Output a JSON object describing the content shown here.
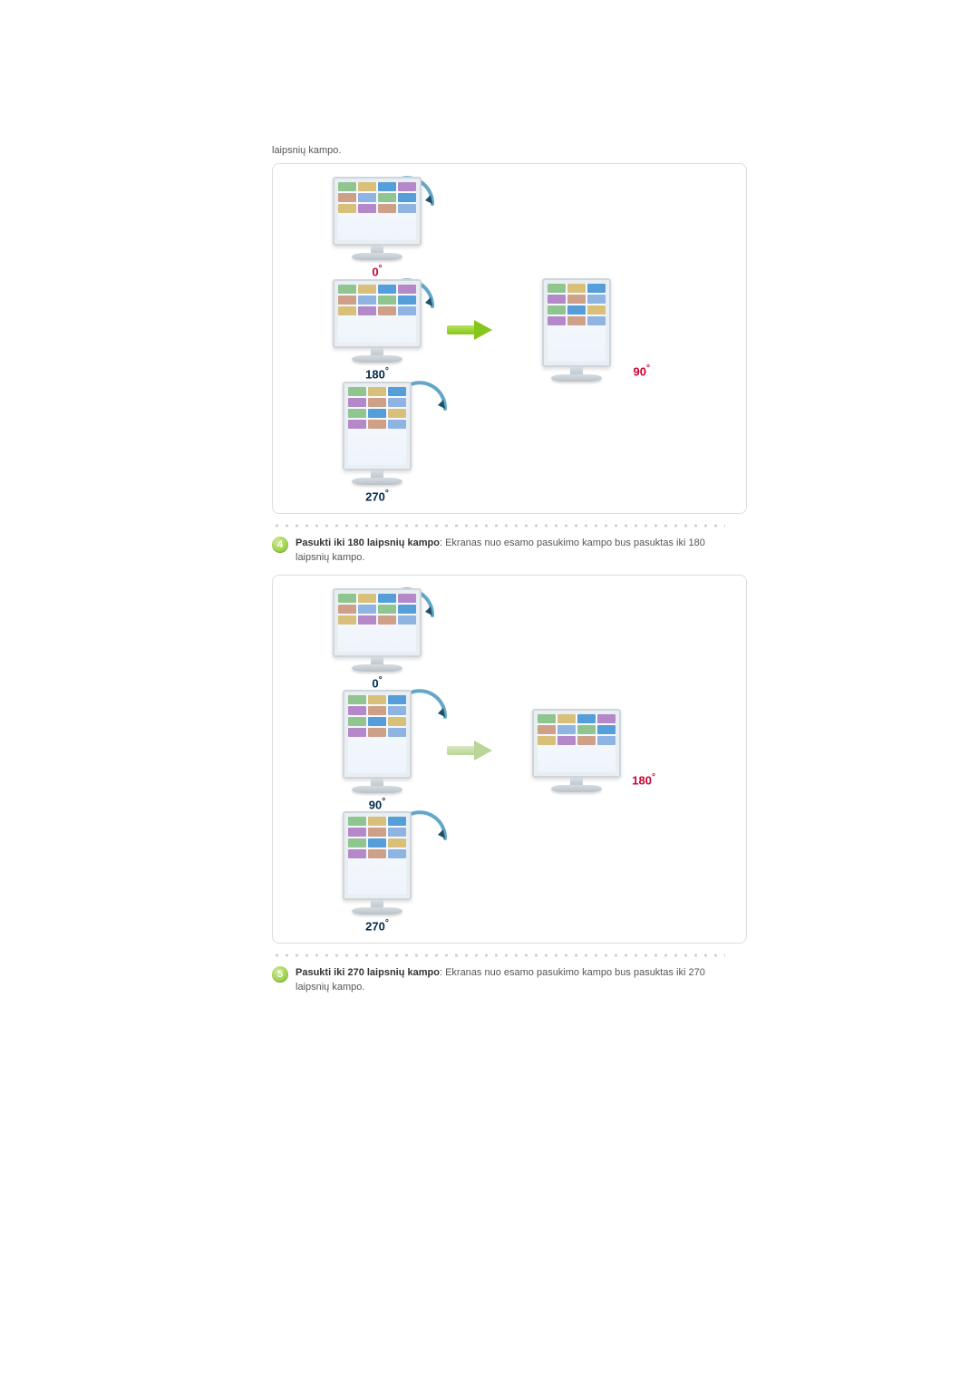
{
  "intro_trailing": "laipsnių kampo.",
  "items": [
    {
      "badge": "4",
      "title": "Pasukti iki 180 laipsnių kampo",
      "desc": ": Ekranas nuo esamo pasukimo kampo bus pasuktas iki 180 laipsnių kampo."
    },
    {
      "badge": "5",
      "title": "Pasukti iki 270 laipsnių kampo",
      "desc": ": Ekranas nuo esamo pasukimo kampo bus pasuktas iki 270 laipsnių kampo."
    }
  ],
  "angles": {
    "a0": "0",
    "a90": "90",
    "a180": "180",
    "a270": "270",
    "deg": "°"
  },
  "diagrams": [
    {
      "sequence_deg": [
        0,
        180,
        270
      ],
      "result_deg": 90,
      "highlight_deg": 90,
      "arrow_style": "solid"
    },
    {
      "sequence_deg": [
        0,
        90,
        270
      ],
      "result_deg": 180,
      "highlight_deg": 180,
      "arrow_style": "muted"
    }
  ]
}
